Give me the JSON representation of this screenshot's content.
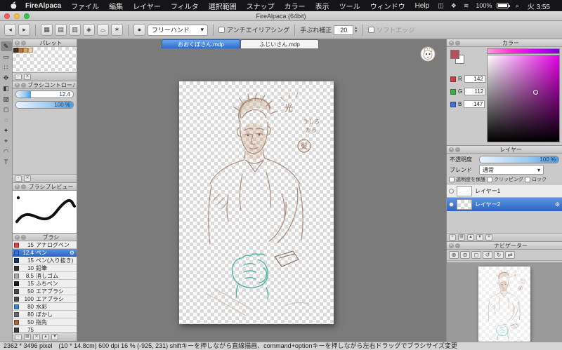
{
  "icons": {
    "close": "✕",
    "collapse": "−",
    "new_item": "▫",
    "folder": "▤",
    "trash": "✕",
    "gear": "⚙",
    "dropdown_arrow": "▾",
    "undo": "◂",
    "redo": "▸",
    "brush_dot": "●",
    "step_up": "▲",
    "step_down": "▼"
  },
  "menubar": {
    "items": [
      "FireAlpaca",
      "ファイル",
      "編集",
      "レイヤー",
      "フィルタ",
      "選択範囲",
      "スナップ",
      "カラー",
      "表示",
      "ツール",
      "ウィンドウ",
      "Help"
    ],
    "status_icons": [
      {
        "name": "displays",
        "glyph": "◫"
      },
      {
        "name": "control-center",
        "glyph": "❖"
      },
      {
        "name": "wifi",
        "glyph": "≋"
      },
      {
        "name": "spotlight",
        "glyph": "⌕"
      }
    ],
    "battery_label": "100%",
    "clock": "火 3:55"
  },
  "window": {
    "title": "FireAlpaca (64bit)"
  },
  "toolbar": {
    "snap_icons": [
      "▦",
      "▤",
      "▥",
      "◈",
      "⌓",
      "✶"
    ],
    "mode_value": "フリーハンド",
    "antialias_label": "アンチエイリアシング",
    "stabilizer_label": "手ぶれ補正",
    "stabilizer_value": "20",
    "soft_edge_label": "ソフトエッジ"
  },
  "tools": [
    {
      "name": "pen-tool",
      "glyph": "✎"
    },
    {
      "name": "eraser-tool",
      "glyph": "▭"
    },
    {
      "name": "dot-tool",
      "glyph": "∷"
    },
    {
      "name": "move-tool",
      "glyph": "✥"
    },
    {
      "name": "fill-tool",
      "glyph": "◧"
    },
    {
      "name": "gradient-tool",
      "glyph": "▨"
    },
    {
      "name": "select-tool",
      "glyph": "◻"
    },
    {
      "name": "lasso-tool",
      "glyph": "◌"
    },
    {
      "name": "magicwand-tool",
      "glyph": "✦"
    },
    {
      "name": "eyedropper-tool",
      "glyph": "⌖"
    },
    {
      "name": "hand-tool",
      "glyph": "◠"
    },
    {
      "name": "text-tool",
      "glyph": "T"
    }
  ],
  "document_tabs": [
    {
      "label": "おおくぼさん.mdp"
    },
    {
      "label": "ふじいさん.mdp"
    }
  ],
  "left_panels": {
    "palette": {
      "title": "パレット",
      "swatches": [
        "#4a3020",
        "#b5713f",
        "#d9a06a",
        "#e8cdb0"
      ]
    },
    "brush_control": {
      "title": "ブラシコントロール",
      "size_value": "12.4",
      "opacity_value": "100 %"
    },
    "brush_preview": {
      "title": "ブラシプレビュー"
    },
    "brush_list": {
      "title": "ブラシ",
      "items": [
        {
          "size": "15",
          "name": "アナログペン",
          "chip": "#e04545"
        },
        {
          "size": "12.4",
          "name": "ペン",
          "chip": "#3a6fd8"
        },
        {
          "size": "15",
          "name": "ペン(入り抜き)",
          "chip": "#16325e"
        },
        {
          "size": "10",
          "name": "鉛筆",
          "chip": "#303030"
        },
        {
          "size": "8.5",
          "name": "消しゴム",
          "chip": "#a8a8a8"
        },
        {
          "size": "15",
          "name": "ふちペン",
          "chip": "#1a1a1a"
        },
        {
          "size": "50",
          "name": "エアブラシ",
          "chip": "#4a4a4a"
        },
        {
          "size": "100",
          "name": "エアブラシ",
          "chip": "#4a4a4a"
        },
        {
          "size": "80",
          "name": "水彩",
          "chip": "#3f86c8"
        },
        {
          "size": "80",
          "name": "ぼかし",
          "chip": "#6a6a6a"
        },
        {
          "size": "50",
          "name": "指先",
          "chip": "#a8683c"
        },
        {
          "size": "75",
          "name": "",
          "chip": "#3a3a3a"
        }
      ]
    }
  },
  "right_panels": {
    "color": {
      "title": "カラー",
      "fg": "#b0525c",
      "r_label": "R",
      "r_value": "142",
      "g_label": "G",
      "g_value": "112",
      "b_label": "B",
      "b_value": "147"
    },
    "layers": {
      "title": "レイヤー",
      "opacity_label": "不透明度",
      "opacity_value": "100 %",
      "blend_label": "ブレンド",
      "blend_value": "通常",
      "protect_alpha_label": "透明度を保護",
      "clipping_label": "クリッピング",
      "lock_label": "ロック",
      "items": [
        {
          "name": "レイヤー1"
        },
        {
          "name": "レイヤー2"
        }
      ],
      "buttons": [
        "+",
        "▤",
        "▲",
        "▼",
        "✕"
      ]
    },
    "navigator": {
      "title": "ナビゲーター",
      "buttons": [
        {
          "name": "zoom-in",
          "glyph": "⊕"
        },
        {
          "name": "zoom-out",
          "glyph": "⊖"
        },
        {
          "name": "fit",
          "glyph": "◻"
        },
        {
          "name": "rotate-left",
          "glyph": "↺"
        },
        {
          "name": "rotate-right",
          "glyph": "↻"
        },
        {
          "name": "flip",
          "glyph": "⇄"
        }
      ]
    }
  },
  "canvas": {
    "annotations": [
      "光",
      "うしろ",
      "から",
      "髪"
    ]
  },
  "statusbar": {
    "text": "2362 * 3496 pixel　(10 * 14.8cm)   600 dpi   16 %  (-925, 231)   shiftキーを押しながら直線描画、command+optionキーを押しながら左右ドラッグでブラシサイズ変更"
  }
}
